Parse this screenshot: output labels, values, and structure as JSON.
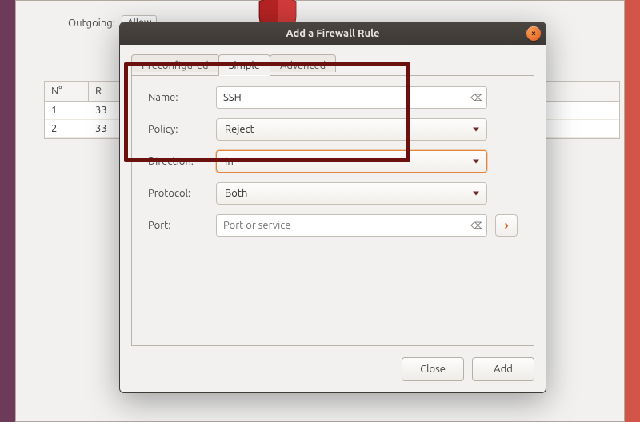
{
  "background": {
    "outgoing_label": "Outgoing:",
    "outgoing_value": "Allow",
    "table": {
      "headers": [
        "N°",
        "R"
      ],
      "rows": [
        [
          "1",
          "33"
        ],
        [
          "2",
          "33"
        ]
      ]
    }
  },
  "dialog": {
    "title": "Add a Firewall Rule",
    "tabs": {
      "preconfigured": "Preconfigured",
      "simple": "Simple",
      "advanced": "Advanced"
    },
    "labels": {
      "name": "Name:",
      "policy": "Policy:",
      "direction": "Direction:",
      "protocol": "Protocol:",
      "port": "Port:"
    },
    "values": {
      "name": "SSH",
      "policy": "Reject",
      "direction": "In",
      "protocol": "Both"
    },
    "port_placeholder": "Port or service",
    "buttons": {
      "close": "Close",
      "add": "Add"
    },
    "close_icon": "×",
    "clear_icon": "⌫",
    "go_icon": "›"
  }
}
